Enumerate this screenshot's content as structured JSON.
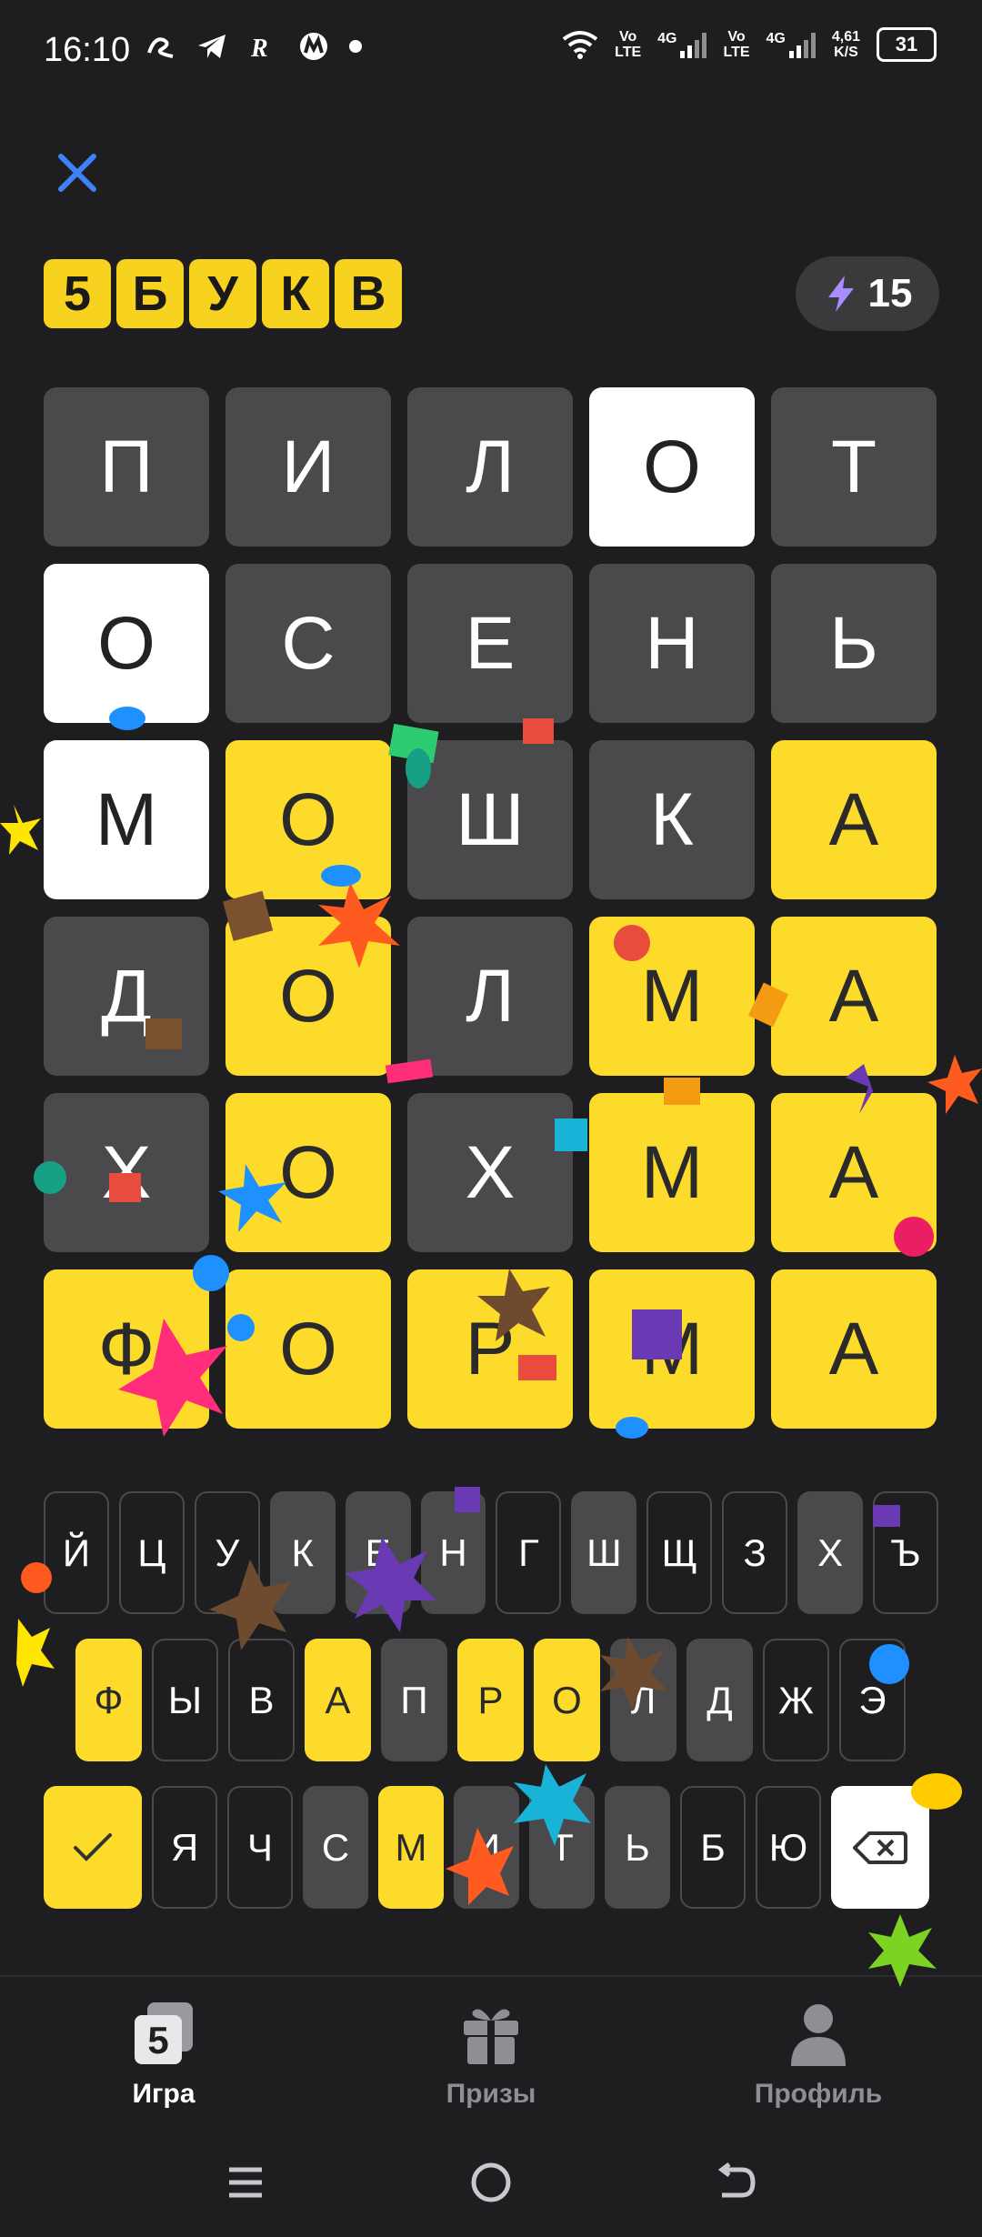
{
  "status_bar": {
    "time": "16:10",
    "net_speed_value": "4,61",
    "net_speed_unit": "K/S",
    "battery": "31",
    "sim1_label_top": "Vo",
    "sim1_label_bottom": "LTE",
    "sim1_gen": "4G",
    "sim2_label_top": "Vo",
    "sim2_label_bottom": "LTE",
    "sim2_gen": "4G"
  },
  "header": {
    "logo_letters": [
      "5",
      "Б",
      "У",
      "К",
      "В"
    ],
    "score": "15"
  },
  "board": [
    [
      {
        "l": "П",
        "s": "absent"
      },
      {
        "l": "И",
        "s": "absent"
      },
      {
        "l": "Л",
        "s": "absent"
      },
      {
        "l": "О",
        "s": "present"
      },
      {
        "l": "Т",
        "s": "absent"
      }
    ],
    [
      {
        "l": "О",
        "s": "present"
      },
      {
        "l": "С",
        "s": "absent"
      },
      {
        "l": "Е",
        "s": "absent"
      },
      {
        "l": "Н",
        "s": "absent"
      },
      {
        "l": "Ь",
        "s": "absent"
      }
    ],
    [
      {
        "l": "М",
        "s": "present"
      },
      {
        "l": "О",
        "s": "correct"
      },
      {
        "l": "Ш",
        "s": "absent"
      },
      {
        "l": "К",
        "s": "absent"
      },
      {
        "l": "А",
        "s": "correct"
      }
    ],
    [
      {
        "l": "Д",
        "s": "absent"
      },
      {
        "l": "О",
        "s": "correct"
      },
      {
        "l": "Л",
        "s": "absent"
      },
      {
        "l": "М",
        "s": "correct"
      },
      {
        "l": "А",
        "s": "correct"
      }
    ],
    [
      {
        "l": "Х",
        "s": "absent"
      },
      {
        "l": "О",
        "s": "correct"
      },
      {
        "l": "Х",
        "s": "absent"
      },
      {
        "l": "М",
        "s": "correct"
      },
      {
        "l": "А",
        "s": "correct"
      }
    ],
    [
      {
        "l": "Ф",
        "s": "correct"
      },
      {
        "l": "О",
        "s": "correct"
      },
      {
        "l": "Р",
        "s": "correct"
      },
      {
        "l": "М",
        "s": "correct"
      },
      {
        "l": "А",
        "s": "correct"
      }
    ]
  ],
  "keyboard": {
    "row1": [
      {
        "l": "Й",
        "s": "unused"
      },
      {
        "l": "Ц",
        "s": "unused"
      },
      {
        "l": "У",
        "s": "unused"
      },
      {
        "l": "К",
        "s": "absent"
      },
      {
        "l": "Е",
        "s": "absent"
      },
      {
        "l": "Н",
        "s": "absent"
      },
      {
        "l": "Г",
        "s": "unused"
      },
      {
        "l": "Ш",
        "s": "absent"
      },
      {
        "l": "Щ",
        "s": "unused"
      },
      {
        "l": "З",
        "s": "unused"
      },
      {
        "l": "Х",
        "s": "absent"
      },
      {
        "l": "Ъ",
        "s": "unused"
      }
    ],
    "row2": [
      {
        "l": "Ф",
        "s": "correct"
      },
      {
        "l": "Ы",
        "s": "unused"
      },
      {
        "l": "В",
        "s": "unused"
      },
      {
        "l": "А",
        "s": "correct"
      },
      {
        "l": "П",
        "s": "absent"
      },
      {
        "l": "Р",
        "s": "correct"
      },
      {
        "l": "О",
        "s": "correct"
      },
      {
        "l": "Л",
        "s": "absent"
      },
      {
        "l": "Д",
        "s": "absent"
      },
      {
        "l": "Ж",
        "s": "unused"
      },
      {
        "l": "Э",
        "s": "unused"
      }
    ],
    "row3": [
      {
        "l": "Я",
        "s": "unused"
      },
      {
        "l": "Ч",
        "s": "unused"
      },
      {
        "l": "С",
        "s": "absent"
      },
      {
        "l": "М",
        "s": "correct"
      },
      {
        "l": "И",
        "s": "absent"
      },
      {
        "l": "Т",
        "s": "absent"
      },
      {
        "l": "Ь",
        "s": "absent"
      },
      {
        "l": "Б",
        "s": "unused"
      },
      {
        "l": "Ю",
        "s": "unused"
      }
    ]
  },
  "tabs": {
    "game": "Игра",
    "prizes": "Призы",
    "profile": "Профиль",
    "game_icon_digit": "5"
  },
  "colors": {
    "accent_yellow": "#fddb2b",
    "tile_gray": "#4a4a4c",
    "background": "#1e1e20",
    "close_blue": "#3e82f7",
    "bolt_purple": "#a98cff"
  }
}
